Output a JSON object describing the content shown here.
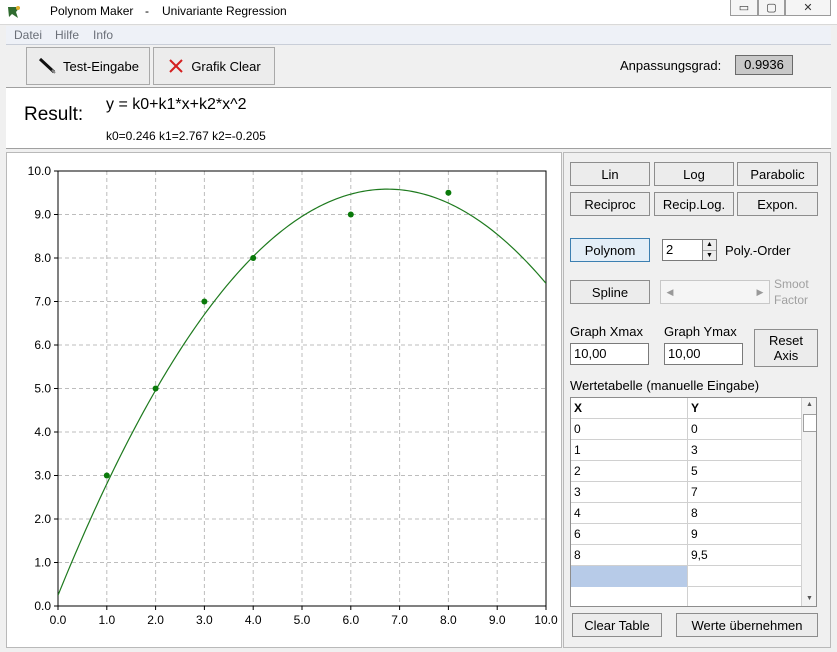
{
  "window": {
    "title": "Polynom Maker",
    "subtitle": "Univariante Regression",
    "controls": {
      "minimize": "▭",
      "maximize": "▢",
      "close": "✕"
    }
  },
  "menu": [
    "Datei",
    "Hilfe",
    "Info"
  ],
  "toolbar": {
    "test_input_label": "Test-Eingabe",
    "clear_graph_label": "Grafik Clear",
    "fit_label": "Anpassungsgrad:",
    "fit_value": "0.9936"
  },
  "result": {
    "label": "Result:",
    "formula": "y = k0+k1*x+k2*x^2",
    "coefficients": "k0=0.246  k1=2.767  k2=-0.205"
  },
  "regression_buttons": [
    [
      "Lin",
      "Log",
      "Parabolic"
    ],
    [
      "Reciproc",
      "Recip.Log.",
      "Expon."
    ]
  ],
  "polynom": {
    "button": "Polynom",
    "order_value": "2",
    "order_label": "Poly.-Order"
  },
  "spline": {
    "button": "Spline",
    "smooth_label_1": "Smoot",
    "smooth_label_2": "Factor"
  },
  "axis": {
    "xmax_label": "Graph Xmax",
    "xmax_value": "10,00",
    "ymax_label": "Graph Ymax",
    "ymax_value": "10,00",
    "reset_label_1": "Reset",
    "reset_label_2": "Axis"
  },
  "table": {
    "title": "Wertetabelle (manuelle Eingabe)",
    "headers": [
      "X",
      "Y"
    ],
    "rows": [
      [
        "0",
        "0"
      ],
      [
        "1",
        "3"
      ],
      [
        "2",
        "5"
      ],
      [
        "3",
        "7"
      ],
      [
        "4",
        "8"
      ],
      [
        "6",
        "9"
      ],
      [
        "8",
        "9,5"
      ]
    ]
  },
  "bottom_buttons": {
    "clear": "Clear Table",
    "apply": "Werte übernehmen"
  },
  "chart_data": {
    "type": "scatter",
    "points": {
      "x": [
        1,
        2,
        3,
        4,
        6,
        8
      ],
      "y": [
        3,
        5,
        7,
        8,
        9,
        9.5
      ]
    },
    "fit": {
      "k0": 0.246,
      "k1": 2.767,
      "k2": -0.205
    },
    "xlim": [
      0,
      10
    ],
    "ylim": [
      0,
      10
    ],
    "x_ticks": [
      "0.0",
      "1.0",
      "2.0",
      "3.0",
      "4.0",
      "5.0",
      "6.0",
      "7.0",
      "8.0",
      "9.0",
      "10.0"
    ],
    "y_ticks": [
      "0.0",
      "1.0",
      "2.0",
      "3.0",
      "4.0",
      "5.0",
      "6.0",
      "7.0",
      "8.0",
      "9.0",
      "10.0"
    ],
    "grid": true,
    "colors": {
      "points": "#0a7a0a",
      "curve": "#1e7a1e",
      "grid": "#bdbdbd"
    }
  }
}
